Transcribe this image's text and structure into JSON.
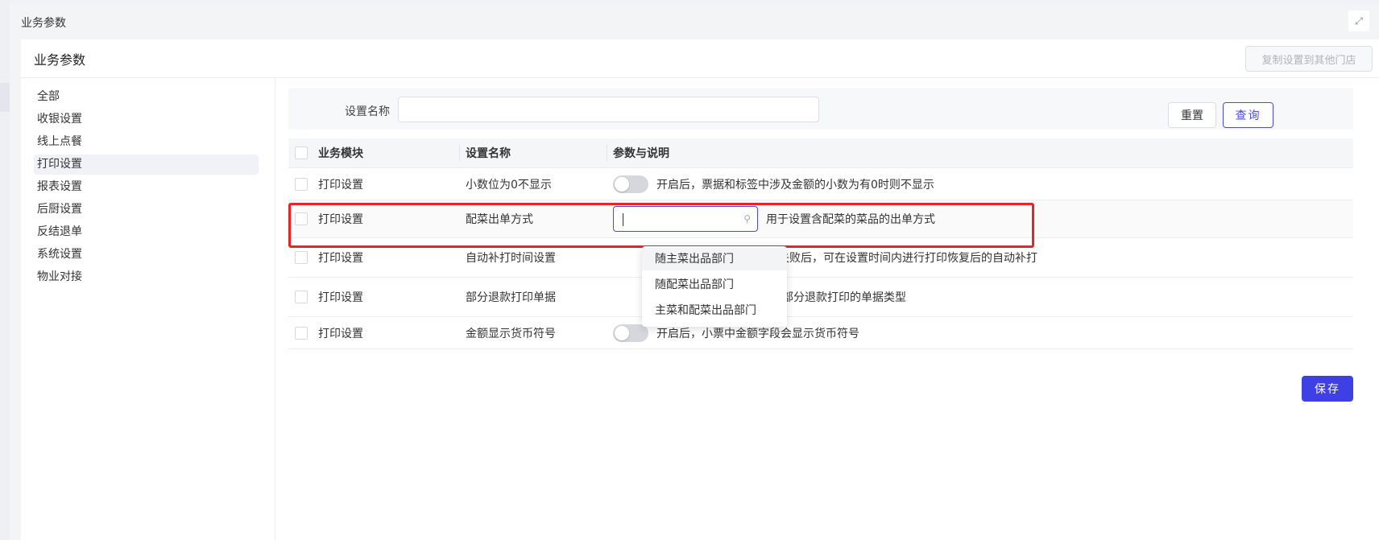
{
  "modal": {
    "title": "业务参数",
    "fullscreen_icon": "expand-icon"
  },
  "card": {
    "title": "业务参数",
    "copy_button": "复制设置到其他门店"
  },
  "sidebar": {
    "items": [
      {
        "label": "全部"
      },
      {
        "label": "收银设置"
      },
      {
        "label": "线上点餐"
      },
      {
        "label": "打印设置",
        "active": true
      },
      {
        "label": "报表设置"
      },
      {
        "label": "后厨设置"
      },
      {
        "label": "反结退单"
      },
      {
        "label": "系统设置"
      },
      {
        "label": "物业对接"
      }
    ]
  },
  "filter": {
    "label": "设置名称",
    "value": "",
    "placeholder": "",
    "reset_label": "重置",
    "query_label": "查询"
  },
  "table": {
    "columns": [
      "业务模块",
      "设置名称",
      "参数与说明"
    ],
    "rows": [
      {
        "module": "打印设置",
        "name": "小数位为0不显示",
        "control": "toggle",
        "enabled": false,
        "desc": "开启后，票据和标签中涉及金额的小数为有0时则不显示"
      },
      {
        "module": "打印设置",
        "name": "配菜出单方式",
        "control": "select",
        "value": "",
        "desc": "用于设置含配菜的菜品的出单方式"
      },
      {
        "module": "打印设置",
        "name": "自动补打时间设置",
        "control": "hidden",
        "desc": "置打印失败后，可在设置时间内进行打印恢复后的自动补打"
      },
      {
        "module": "打印设置",
        "name": "部分退款打印单据",
        "control": "hidden",
        "desc": "配置部分退款打印的单据类型"
      },
      {
        "module": "打印设置",
        "name": "金额显示货币符号",
        "control": "toggle",
        "enabled": false,
        "desc": "开启后，小票中金额字段会显示货币符号"
      }
    ]
  },
  "dropdown": {
    "options": [
      "随主菜出品部门",
      "随配菜出品部门",
      "主菜和配菜出品部门"
    ],
    "hover_index": 0
  },
  "footer": {
    "save_label": "保存"
  },
  "colors": {
    "primary": "#3f3fe6",
    "highlight": "#e82525"
  }
}
